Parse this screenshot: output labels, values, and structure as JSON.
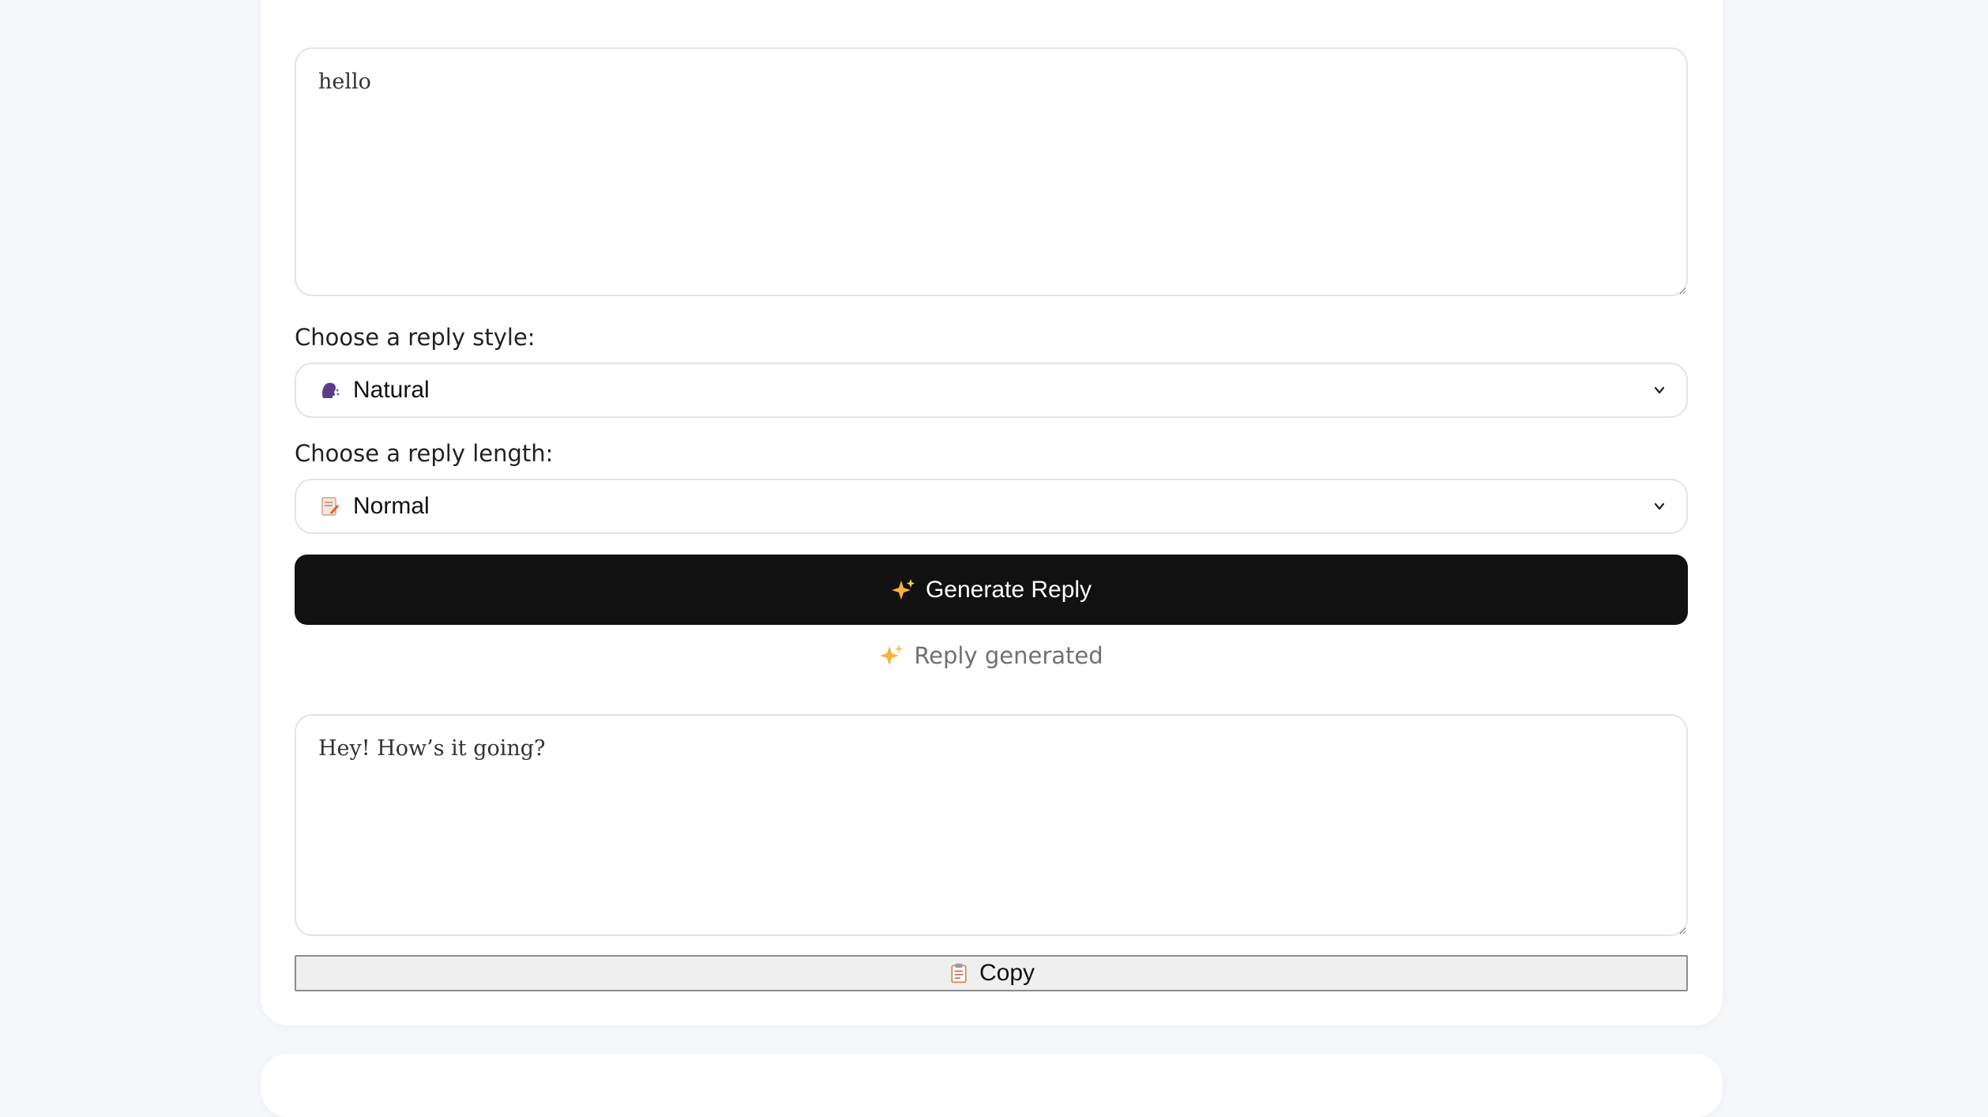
{
  "header": {
    "subtitle_fragment": ""
  },
  "input": {
    "value": "hello"
  },
  "style_select": {
    "label": "Choose a reply style:",
    "selected_text": "Natural",
    "icon": "speaking-head-icon"
  },
  "length_select": {
    "label": "Choose a reply length:",
    "selected_text": "Normal",
    "icon": "memo-icon"
  },
  "generate_button": {
    "label": "Generate Reply",
    "icon": "sparkles-icon"
  },
  "status": {
    "text": "Reply generated",
    "icon": "sparkles-icon"
  },
  "output": {
    "value": "Hey! How’s it going?"
  },
  "copy_button": {
    "label": "Copy",
    "icon": "clipboard-icon"
  },
  "colors": {
    "page_background": "#f6f7fb",
    "primary_button": "#111111",
    "card_background": "#ffffff"
  }
}
